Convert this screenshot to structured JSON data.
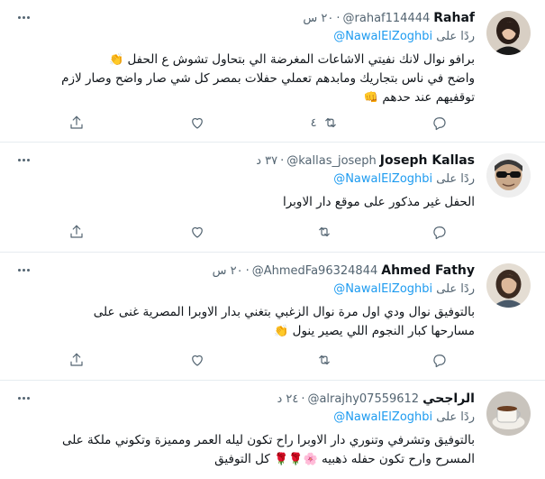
{
  "tweets": [
    {
      "name": "Rahaf",
      "handle": "@rahaf114444",
      "time": "٢٠ س",
      "replying_prefix": "ردًا على",
      "replying_to": "@NawalElZoghbi",
      "lines": [
        "برافو نوال لانك نفيتي الاشاعات المغرضة الي بتحاول تشوش ع الحفل",
        "واضح في ناس بتجاريك ومابدهم تعملي حفلات بمصر كل شي صار واضح وصار لازم",
        "توقفيهم عند حدهم"
      ],
      "emoji_line1": "👏",
      "emoji_line3": "👊",
      "reply_count": "",
      "retweet_count": "٤",
      "like_count": "",
      "avatar": "woman-portrait"
    },
    {
      "name": "Joseph Kallas",
      "handle": "@kallas_joseph",
      "time": "٣٧ د",
      "replying_prefix": "ردًا على",
      "replying_to": "@NawalElZoghbi",
      "lines": [
        "الحفل غير مذكور على موقع دار الاوبرا"
      ],
      "reply_count": "",
      "retweet_count": "",
      "like_count": "",
      "avatar": "man-sunglasses"
    },
    {
      "name": "Ahmed Fathy",
      "handle": "@AhmedFa96324844",
      "time": "٢٠ س",
      "replying_prefix": "ردًا على",
      "replying_to": "@NawalElZoghbi",
      "lines": [
        "بالتوفيق نوال ودي اول مرة نوال الزغبي بتغني بدار الاوبرا المصرية غنى على",
        "مسارحها كبار النجوم اللي يصير ينول"
      ],
      "emoji_line2": "👏",
      "reply_count": "",
      "retweet_count": "",
      "like_count": "",
      "avatar": "woman-portrait-2"
    },
    {
      "name": "الراجحي",
      "handle": "@alrajhy07559612",
      "time": "٢٤ د",
      "replying_prefix": "ردًا على",
      "replying_to": "@NawalElZoghbi",
      "lines": [
        "بالتوفيق وتشرفي وتنوري دار الاوبرا راح تكون ليله العمر ومميزة وتكوني ملكة على",
        "المسرح وارح تكون حفله ذهبيه",
        "كل التوفيق"
      ],
      "emojis_line2": "🌸🌹🌹",
      "reply_count": "",
      "retweet_count": "",
      "like_count": "",
      "avatar": "coffee-cup"
    }
  ],
  "colors": {
    "accent": "#1d9bf0",
    "secondary_text": "#536471",
    "divider": "#e6ecf0"
  }
}
